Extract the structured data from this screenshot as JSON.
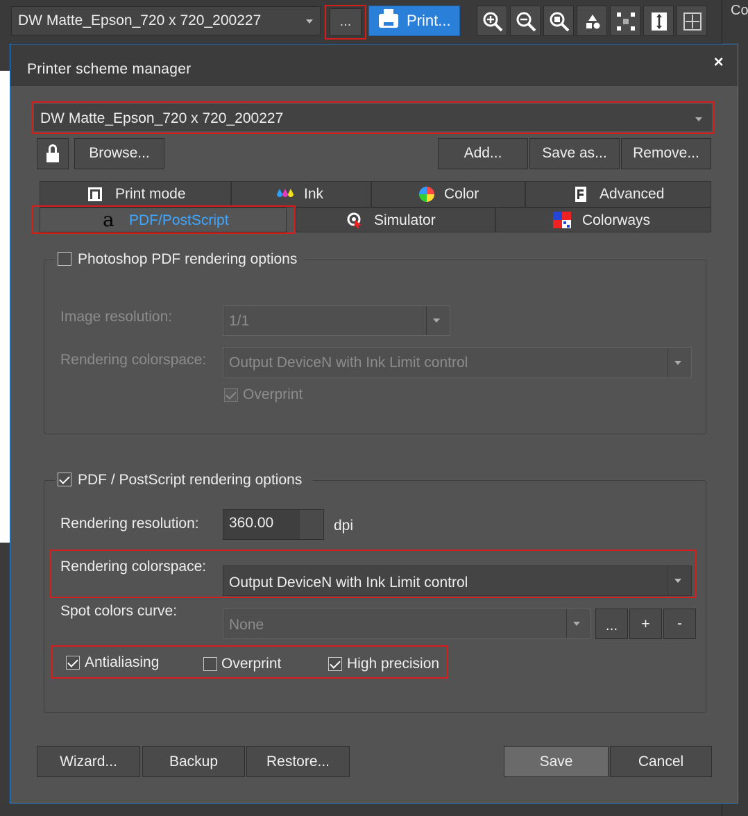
{
  "toolbar": {
    "scheme_value": "DW Matte_Epson_720 x 720_200227",
    "dots_label": "...",
    "print_label": "Print...",
    "right_label": "Co"
  },
  "dialog": {
    "title": "Printer scheme manager",
    "close": "×",
    "scheme_value": "DW Matte_Epson_720 x 720_200227",
    "browse": "Browse...",
    "add": "Add...",
    "save_as": "Save as...",
    "remove": "Remove...",
    "tabs_row1": [
      "Print mode",
      "Ink",
      "Color",
      "Advanced"
    ],
    "tabs_row2": [
      "PDF/PostScript",
      "Simulator",
      "Colorways"
    ],
    "active_tab": "PDF/PostScript",
    "photoshop_group": {
      "title": "Photoshop PDF rendering options",
      "checked": false,
      "image_resolution_label": "Image resolution:",
      "image_resolution_value": "1/1",
      "colorspace_label": "Rendering colorspace:",
      "colorspace_value": "Output DeviceN with Ink Limit control",
      "overprint_label": "Overprint",
      "overprint_checked": true
    },
    "pdf_group": {
      "title": "PDF / PostScript rendering options",
      "checked": true,
      "resolution_label": "Rendering resolution:",
      "resolution_value": "360.00",
      "resolution_unit": "dpi",
      "colorspace_label": "Rendering colorspace:",
      "colorspace_value": "Output DeviceN with Ink Limit control",
      "spot_label": "Spot colors curve:",
      "spot_value": "None",
      "spot_dots": "...",
      "spot_plus": "+",
      "spot_minus": "-",
      "antialiasing_label": "Antialiasing",
      "antialiasing_checked": true,
      "overprint_label": "Overprint",
      "overprint_checked": false,
      "high_precision_label": "High precision",
      "high_precision_checked": true
    },
    "footer": {
      "wizard": "Wizard...",
      "backup": "Backup",
      "restore": "Restore...",
      "save": "Save",
      "cancel": "Cancel"
    }
  },
  "colors": {
    "accent_blue": "#2a7fd8",
    "highlight_red": "#d91c1c",
    "active_tab_text": "#3fa7ff"
  }
}
